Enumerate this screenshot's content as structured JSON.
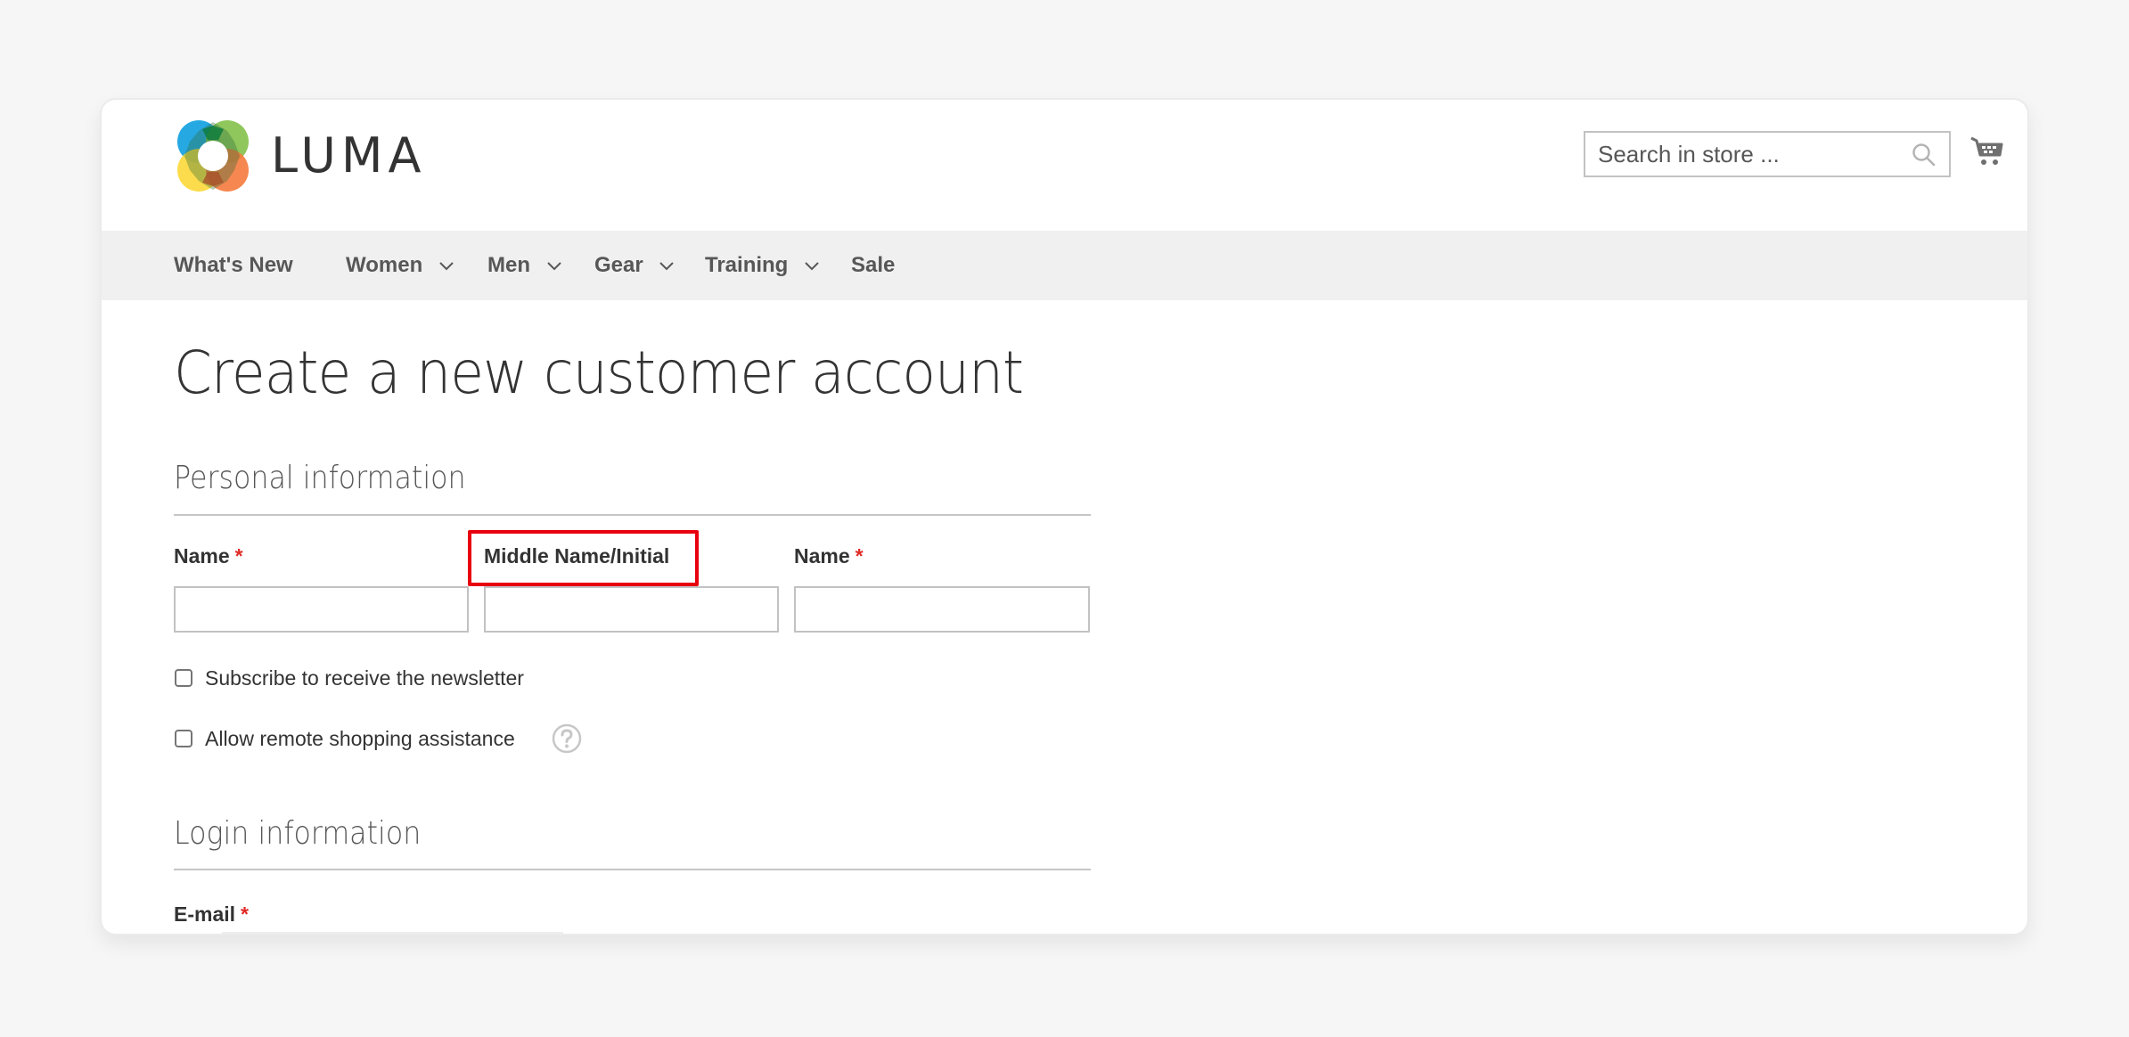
{
  "header": {
    "logo_text": "LUMA",
    "logo_icon": "luma-logo-icon",
    "search": {
      "placeholder": "Search in store ...",
      "value": "",
      "icon": "search-icon"
    },
    "cart_icon": "cart-icon"
  },
  "nav": {
    "items": [
      {
        "label": "What's New",
        "has_dropdown": false
      },
      {
        "label": "Women",
        "has_dropdown": true
      },
      {
        "label": "Men",
        "has_dropdown": true
      },
      {
        "label": "Gear",
        "has_dropdown": true
      },
      {
        "label": "Training",
        "has_dropdown": true
      },
      {
        "label": "Sale",
        "has_dropdown": false
      }
    ]
  },
  "page": {
    "title": "Create a new customer account",
    "personal": {
      "heading": "Personal information",
      "fields": [
        {
          "label": "Name",
          "required": true,
          "required_mark": "*",
          "value": ""
        },
        {
          "label": "Middle Name/Initial",
          "required": false,
          "value": "",
          "highlighted": true
        },
        {
          "label": "Name",
          "required": true,
          "required_mark": "*",
          "value": ""
        }
      ],
      "checkboxes": [
        {
          "label": "Subscribe to receive the newsletter",
          "checked": false
        },
        {
          "label": "Allow remote shopping assistance",
          "checked": false,
          "help_icon": "question-circle-icon"
        }
      ]
    },
    "login": {
      "heading": "Login information",
      "fields": [
        {
          "label": "E-mail",
          "required": true,
          "required_mark": "*"
        }
      ]
    }
  },
  "colors": {
    "highlight": "#e8000f",
    "required": "#e02b27",
    "nav_bg": "#f0f0f0",
    "page_bg": "#f6f6f6"
  }
}
